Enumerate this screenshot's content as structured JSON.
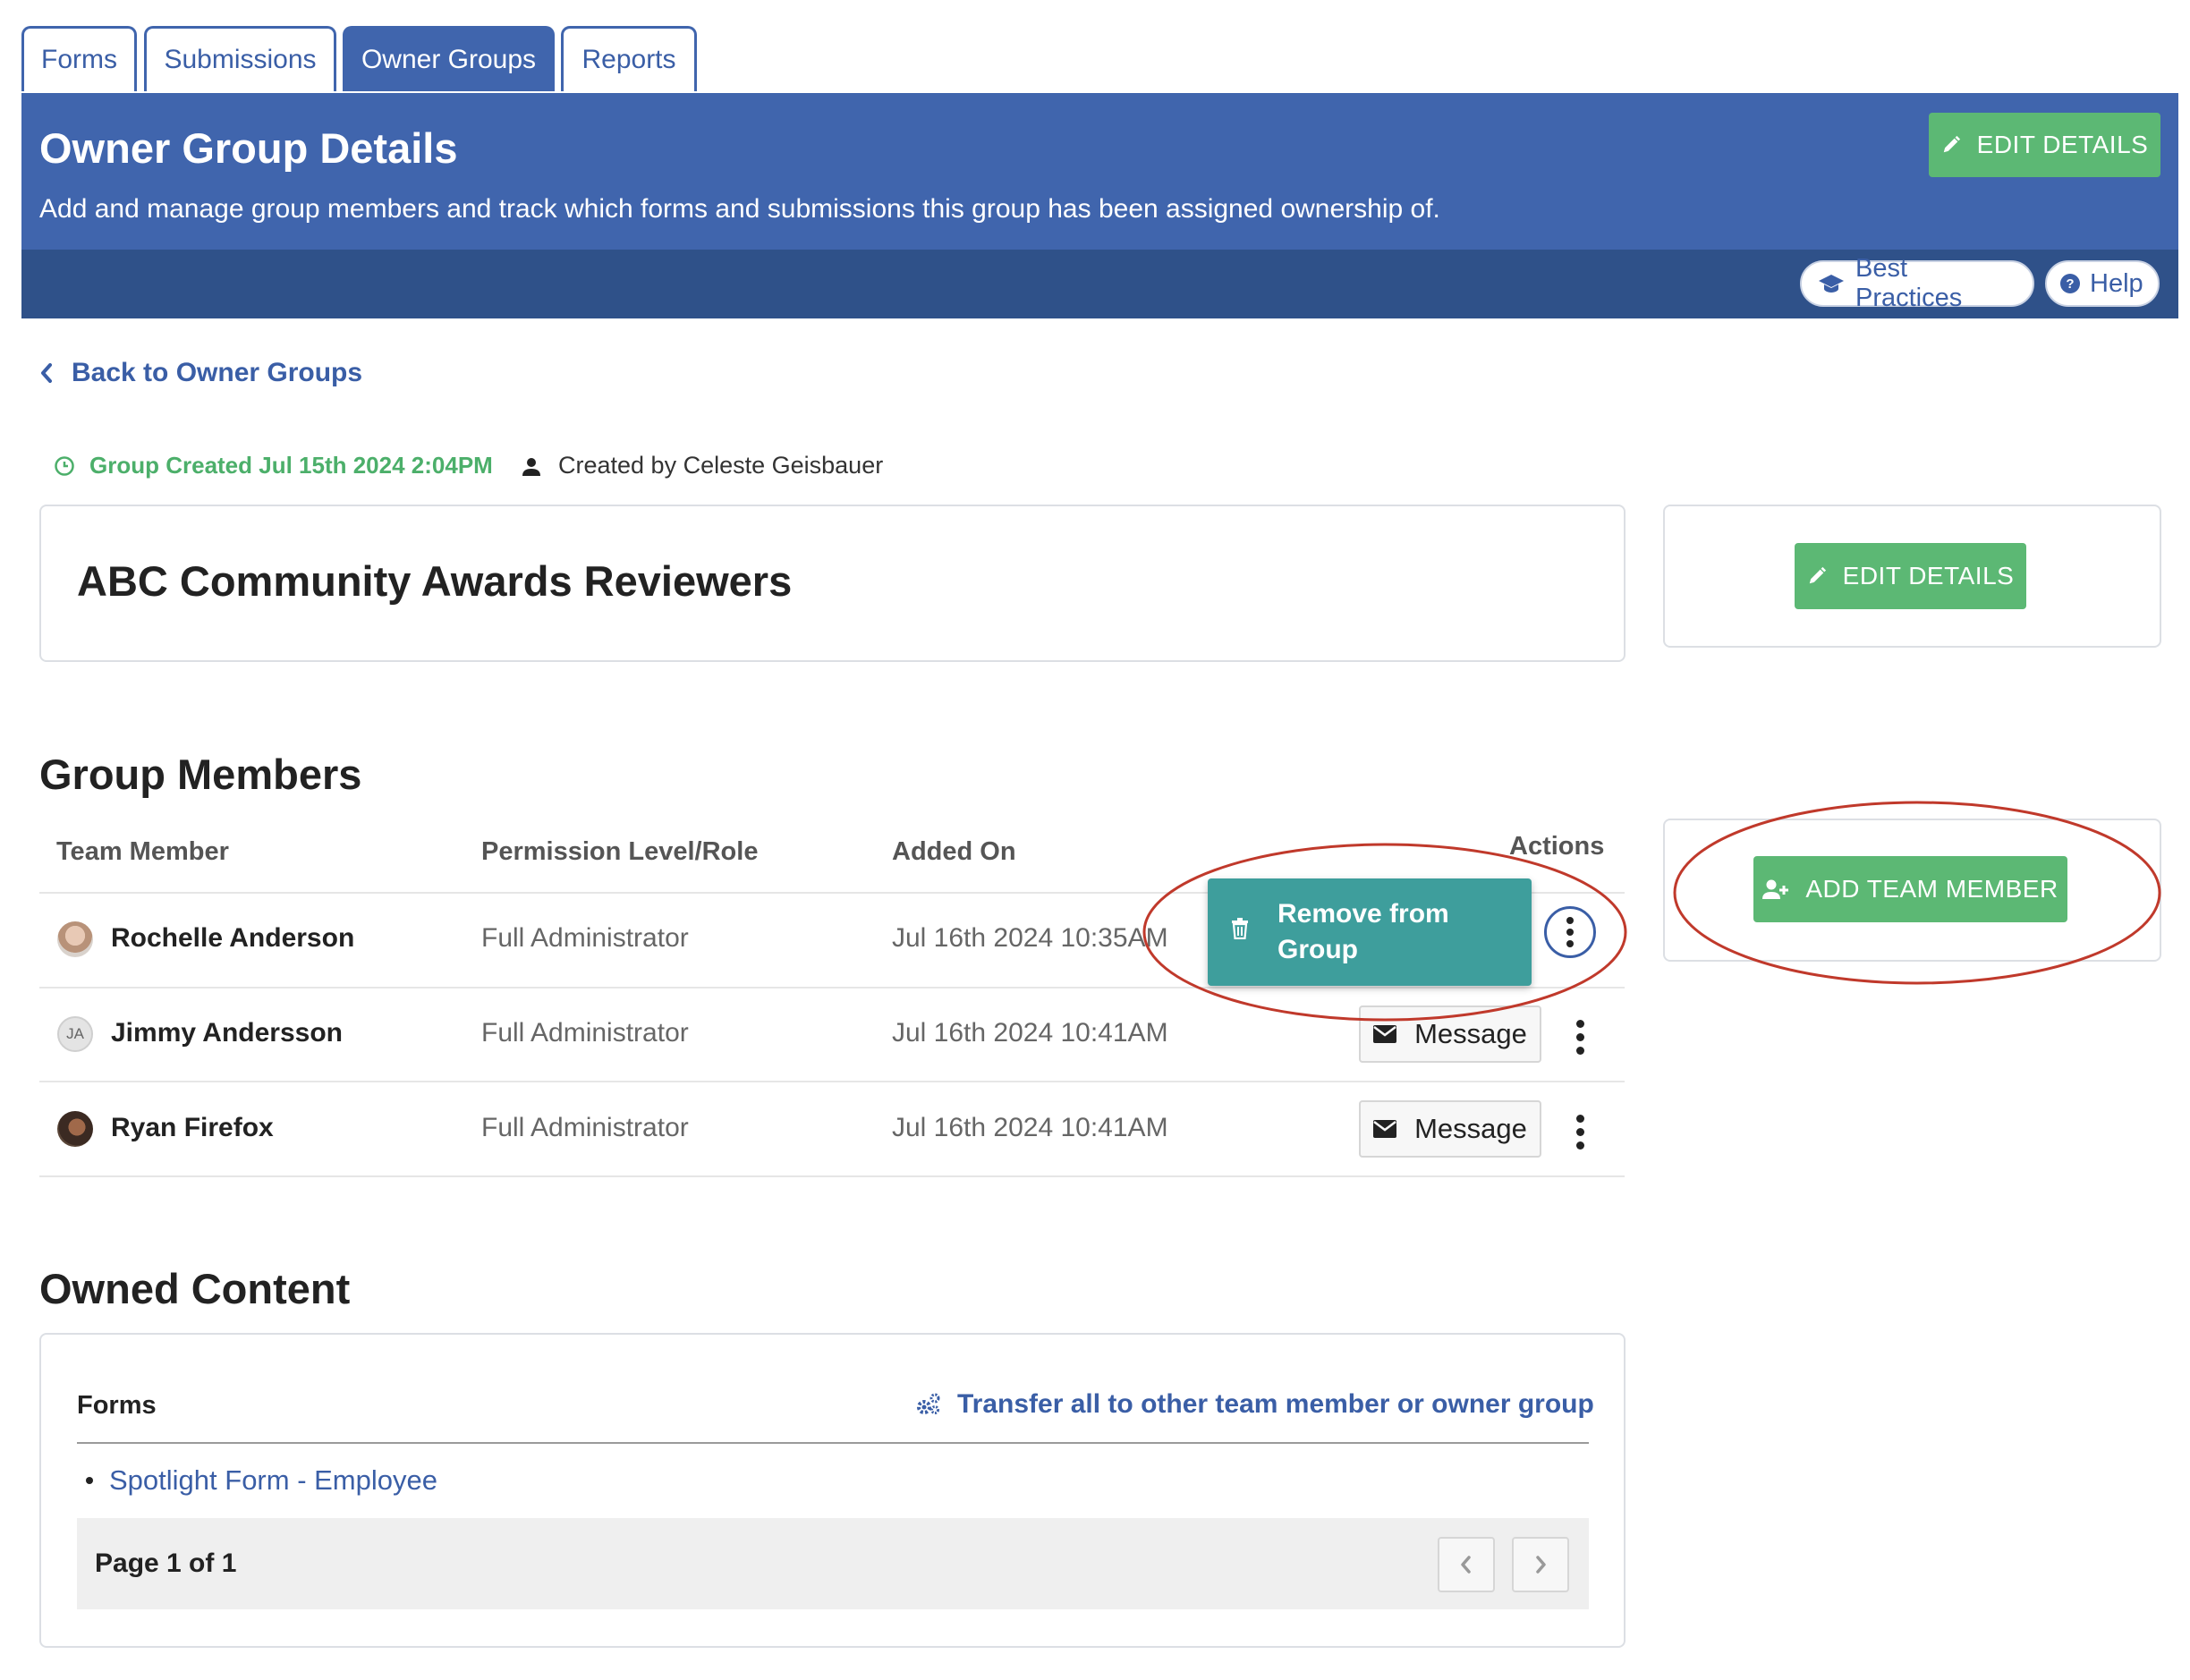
{
  "tabs": [
    {
      "label": "Forms"
    },
    {
      "label": "Submissions"
    },
    {
      "label": "Owner Groups",
      "active": true
    },
    {
      "label": "Reports"
    }
  ],
  "header": {
    "title": "Owner Group Details",
    "subtitle": "Add and manage group members and track which forms and submissions this group has been assigned ownership of.",
    "edit_label": "EDIT DETAILS",
    "best_practices_label": "Best Practices",
    "help_label": "Help"
  },
  "back_link": "Back to Owner Groups",
  "meta": {
    "created": "Group Created Jul 15th 2024 2:04PM",
    "created_by": "Created by Celeste Geisbauer"
  },
  "group": {
    "name": "ABC Community Awards Reviewers",
    "edit_label": "EDIT DETAILS"
  },
  "members": {
    "title": "Group Members",
    "columns": [
      "Team Member",
      "Permission Level/Role",
      "Added On",
      "Actions"
    ],
    "rows": [
      {
        "name": "Rochelle Anderson",
        "role": "Full Administrator",
        "added": "Jul 16th 2024 10:35AM"
      },
      {
        "name": "Jimmy Andersson",
        "initials": "JA",
        "role": "Full Administrator",
        "added": "Jul 16th 2024 10:41AM",
        "action": "Message"
      },
      {
        "name": "Ryan Firefox",
        "role": "Full Administrator",
        "added": "Jul 16th 2024 10:41AM",
        "action": "Message"
      }
    ],
    "menu_item": "Remove from Group",
    "remove_line1": "Remove from",
    "remove_line2": "Group",
    "add_label": "ADD TEAM MEMBER"
  },
  "owned": {
    "title": "Owned Content",
    "forms_label": "Forms",
    "transfer_label": "Transfer all to other team member or owner group",
    "forms": [
      "Spotlight Form - Employee"
    ],
    "page_label": "Page 1 of 1"
  },
  "colors": {
    "brand_blue": "#4065ad",
    "banner_dark": "#2f5189",
    "green": "#5cb874",
    "teal_menu": "#3e9e9c",
    "annotation_red": "#c0392b"
  },
  "icons": [
    "pencil-icon",
    "graduation-cap-icon",
    "question-circle-icon",
    "chevron-left-icon",
    "clock-icon",
    "user-icon",
    "user-plus-icon",
    "trash-icon",
    "envelope-icon",
    "kebab-icon",
    "cogs-icon",
    "chevron-right-icon"
  ]
}
